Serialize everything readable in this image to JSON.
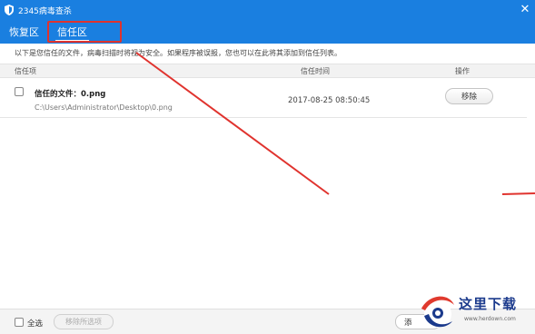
{
  "window": {
    "title": "2345病毒查杀",
    "close_glyph": "✕",
    "accent_color": "#1a7fe0"
  },
  "tabs": [
    {
      "label": "恢复区",
      "active": false
    },
    {
      "label": "信任区",
      "active": true
    }
  ],
  "notice": "以下是您信任的文件，病毒扫描时将视为安全。如果程序被误报，您也可以在此将其添加到信任列表。",
  "table": {
    "headers": {
      "item": "信任项",
      "time": "信任时间",
      "action": "操作"
    },
    "rows": [
      {
        "name": "信任的文件：0.png",
        "path": "C:\\Users\\Administrator\\Desktop\\0.png",
        "time": "2017-08-25 08:50:45",
        "action_label": "移除",
        "checked": false
      }
    ]
  },
  "footer": {
    "select_all_label": "全选",
    "remove_selected_label": "移除所选项",
    "add_label": "添"
  },
  "watermark": {
    "text": "这里下载",
    "url": "www.herdown.com"
  },
  "annotation_color": "#e0332e"
}
